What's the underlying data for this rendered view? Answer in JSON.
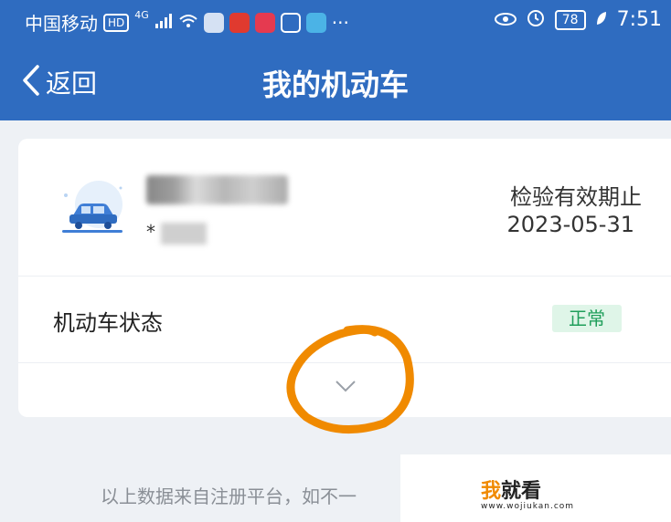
{
  "status_bar": {
    "carrier": "中国移动",
    "hd": "HD",
    "network": "4G",
    "battery": "78",
    "time": "7:51"
  },
  "nav": {
    "back_label": "返回",
    "title": "我的机动车"
  },
  "vehicle": {
    "plate": "",
    "type_prefix": "*",
    "expiry_label": "检验有效期止",
    "expiry_date": "2023-05-31"
  },
  "status": {
    "label": "机动车状态",
    "value": "正常"
  },
  "footer": {
    "note": "以上数据来自注册平台，如不一"
  },
  "watermark": {
    "logo_part1": "我",
    "logo_part2": "就看",
    "url": "www.wojiukan.com"
  },
  "colors": {
    "header_bg": "#2f6cc0",
    "status_green": "#1e9e5a",
    "annotation_orange": "#f08a00"
  }
}
